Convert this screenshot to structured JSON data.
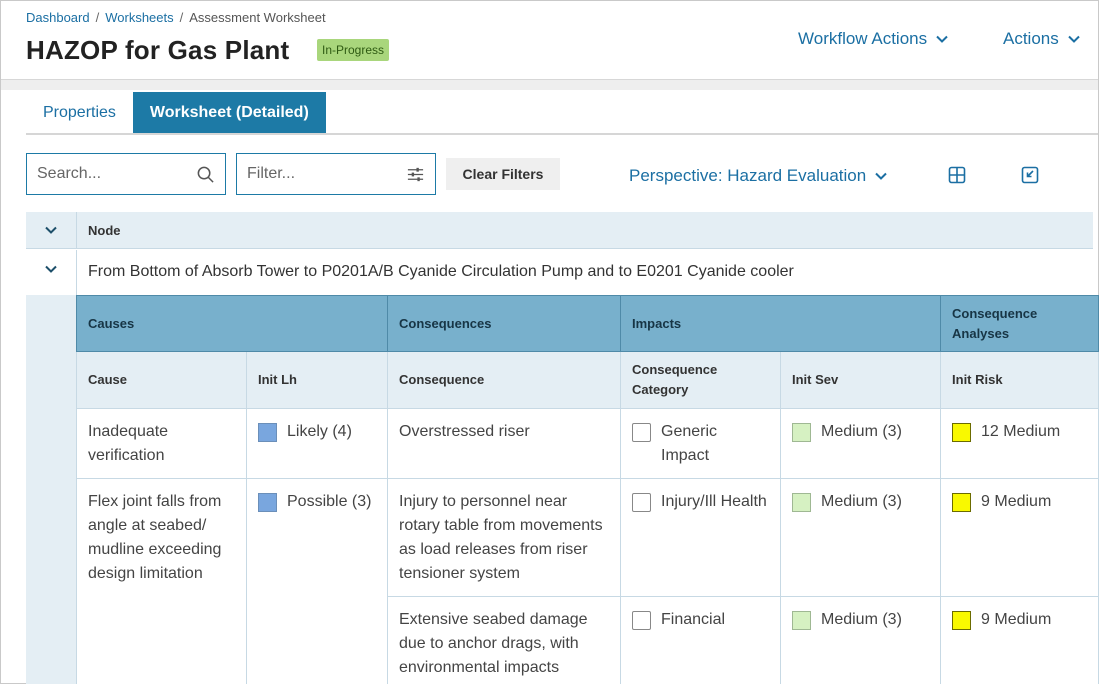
{
  "breadcrumb": {
    "dashboard": "Dashboard",
    "worksheets": "Worksheets",
    "current": "Assessment Worksheet",
    "sep": "/"
  },
  "header": {
    "title": "HAZOP for Gas Plant",
    "status": "In-Progress",
    "workflow_actions": "Workflow Actions",
    "actions": "Actions"
  },
  "tabs": [
    {
      "label": "Properties"
    },
    {
      "label": "Worksheet (Detailed)"
    }
  ],
  "toolbar": {
    "search_placeholder": "Search...",
    "filter_placeholder": "Filter...",
    "clear_filters": "Clear Filters",
    "perspective": "Perspective: Hazard Evaluation"
  },
  "node": {
    "header": "Node",
    "text": "From Bottom of Absorb Tower to P0201A/B Cyanide Circulation Pump and to E0201 Cyanide cooler"
  },
  "table": {
    "groups": {
      "causes": "Causes",
      "consequences": "Consequences",
      "impacts": "Impacts",
      "analyses": "Consequence Analyses"
    },
    "columns": {
      "cause": "Cause",
      "init_lh": "Init Lh",
      "consequence": "Consequence",
      "category": "Consequence Category",
      "init_sev": "Init Sev",
      "init_risk": "Init Risk"
    },
    "rows": [
      {
        "cause": "Inadequate verification",
        "init_lh": "Likely (4)",
        "consequence": "Overstressed riser",
        "category": "Generic Impact",
        "init_sev": "Medium (3)",
        "init_risk": "12 Medium"
      },
      {
        "cause": "Flex joint falls from angle at seabed/ mudline exceeding design limitation",
        "init_lh": "Possible (3)",
        "consequence": "Injury to personnel near rotary table from movements as load releases from riser tensioner system",
        "category": "Injury/Ill Health",
        "init_sev": "Medium (3)",
        "init_risk": "9 Medium"
      },
      {
        "consequence": "Extensive seabed damage due to anchor drags, with environmental impacts",
        "category": "Financial",
        "init_sev": "Medium (3)",
        "init_risk": "9 Medium"
      }
    ]
  },
  "colors": {
    "accent": "#1d7aa6",
    "status_badge": "#a9d67c",
    "likelihood": "#79a6de",
    "severity_medium": "#d6f1c2",
    "risk_medium": "#f9f900"
  }
}
